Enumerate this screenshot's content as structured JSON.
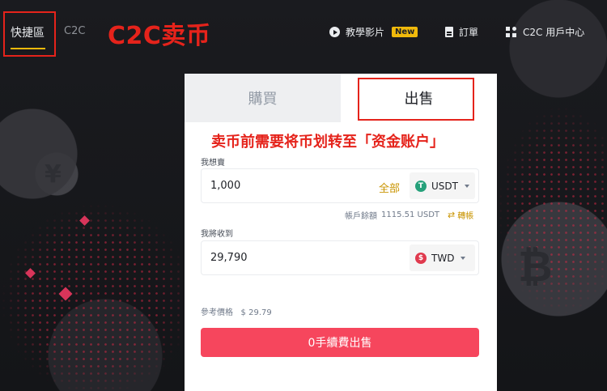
{
  "topbar": {
    "quick_tab": "快捷區",
    "c2c_tab": "C2C",
    "annotation_title": "C2C卖币",
    "tutorial": "教學影片",
    "new_badge": "New",
    "orders": "訂單",
    "user_center": "C2C 用戶中心"
  },
  "card": {
    "buy_tab": "購買",
    "sell_tab": "出售",
    "annotation_note": "卖币前需要将币划转至「资金账户」",
    "want_sell_label": "我想賣",
    "sell_amount": "1,000",
    "all_link": "全部",
    "sell_currency": "USDT",
    "balance_label": "帳戶餘額",
    "balance_value": "1115.51 USDT",
    "transfer_label": "轉帳",
    "receive_label": "我將收到",
    "receive_amount": "29,790",
    "receive_currency": "TWD",
    "ref_price_label": "參考價格",
    "ref_price_value": "$ 29.79",
    "submit_button": "0手續費出售"
  },
  "colors": {
    "accent_yellow": "#f0b90b",
    "sell_red": "#f6465d",
    "annotation_red": "#e5231b",
    "usdt_green": "#26a17b",
    "twd_red": "#e03a4e"
  }
}
